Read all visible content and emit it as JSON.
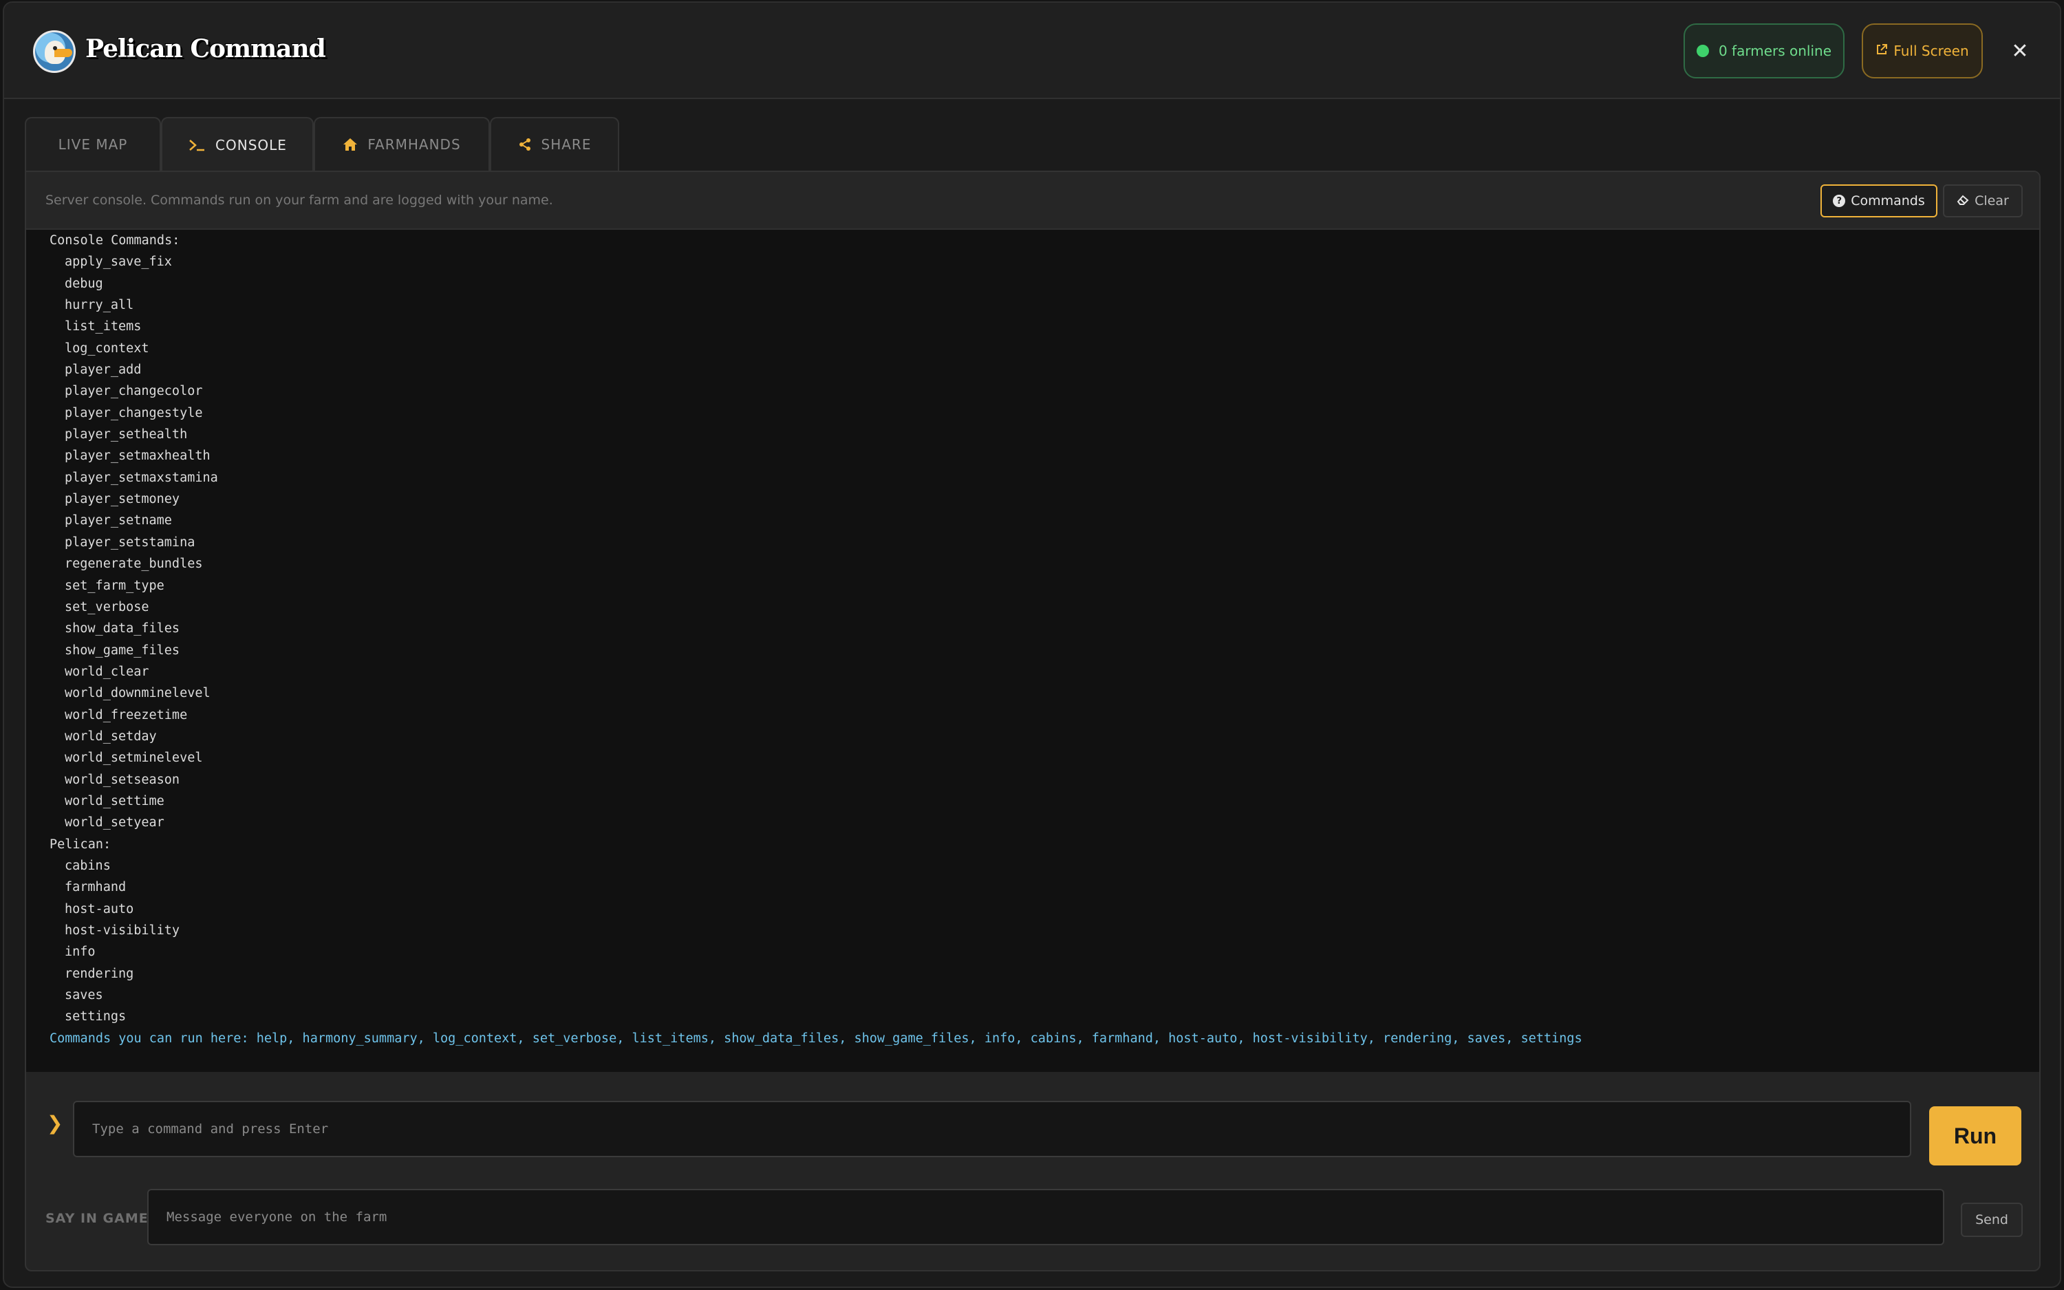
{
  "header": {
    "brand": "Pelican Command",
    "online_label": "0 farmers online",
    "fullscreen_label": "Full Screen",
    "close_glyph": "✕"
  },
  "tabs": [
    {
      "label": "LIVE MAP",
      "icon": "",
      "active": false
    },
    {
      "label": "CONSOLE",
      "icon": "terminal-icon",
      "active": true
    },
    {
      "label": "FARMHANDS",
      "icon": "home-icon",
      "active": false
    },
    {
      "label": "SHARE",
      "icon": "share-icon",
      "active": false
    }
  ],
  "panel": {
    "hint": "Server console. Commands run on your farm and are logged with your name.",
    "commands_label": "Commands",
    "clear_label": "Clear"
  },
  "console": {
    "lines": [
      {
        "text": "Console Commands:",
        "indent": false
      },
      {
        "text": "apply_save_fix",
        "indent": true
      },
      {
        "text": "debug",
        "indent": true
      },
      {
        "text": "hurry_all",
        "indent": true
      },
      {
        "text": "list_items",
        "indent": true
      },
      {
        "text": "log_context",
        "indent": true
      },
      {
        "text": "player_add",
        "indent": true
      },
      {
        "text": "player_changecolor",
        "indent": true
      },
      {
        "text": "player_changestyle",
        "indent": true
      },
      {
        "text": "player_sethealth",
        "indent": true
      },
      {
        "text": "player_setmaxhealth",
        "indent": true
      },
      {
        "text": "player_setmaxstamina",
        "indent": true
      },
      {
        "text": "player_setmoney",
        "indent": true
      },
      {
        "text": "player_setname",
        "indent": true
      },
      {
        "text": "player_setstamina",
        "indent": true
      },
      {
        "text": "regenerate_bundles",
        "indent": true
      },
      {
        "text": "set_farm_type",
        "indent": true
      },
      {
        "text": "set_verbose",
        "indent": true
      },
      {
        "text": "show_data_files",
        "indent": true
      },
      {
        "text": "show_game_files",
        "indent": true
      },
      {
        "text": "world_clear",
        "indent": true
      },
      {
        "text": "world_downminelevel",
        "indent": true
      },
      {
        "text": "world_freezetime",
        "indent": true
      },
      {
        "text": "world_setday",
        "indent": true
      },
      {
        "text": "world_setminelevel",
        "indent": true
      },
      {
        "text": "world_setseason",
        "indent": true
      },
      {
        "text": "world_settime",
        "indent": true
      },
      {
        "text": "world_setyear",
        "indent": true
      },
      {
        "text": "Pelican:",
        "indent": false
      },
      {
        "text": "cabins",
        "indent": true
      },
      {
        "text": "farmhand",
        "indent": true
      },
      {
        "text": "host-auto",
        "indent": true
      },
      {
        "text": "host-visibility",
        "indent": true
      },
      {
        "text": "info",
        "indent": true
      },
      {
        "text": "rendering",
        "indent": true
      },
      {
        "text": "saves",
        "indent": true
      },
      {
        "text": "settings",
        "indent": true
      }
    ],
    "summary": "Commands you can run here: help, harmony_summary, log_context, set_verbose, list_items, show_data_files, show_game_files, info, cabins, farmhand, host-auto, host-visibility, rendering, saves, settings"
  },
  "command": {
    "prompt": "❯",
    "placeholder": "Type a command and press Enter",
    "value": "",
    "run_label": "Run"
  },
  "say": {
    "label": "SAY IN GAME",
    "placeholder": "Message everyone on the farm",
    "value": "",
    "send_label": "Send"
  },
  "colors": {
    "accent": "#f0b33a",
    "online": "#3ed16b",
    "summary_text": "#6ec3ea"
  }
}
